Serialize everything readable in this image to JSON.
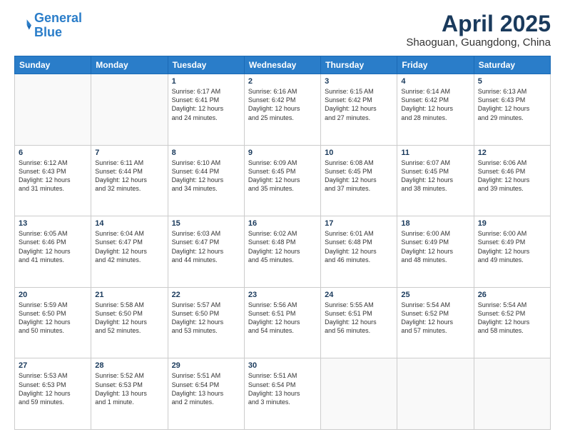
{
  "header": {
    "logo_line1": "General",
    "logo_line2": "Blue",
    "main_title": "April 2025",
    "subtitle": "Shaoguan, Guangdong, China"
  },
  "days_of_week": [
    "Sunday",
    "Monday",
    "Tuesday",
    "Wednesday",
    "Thursday",
    "Friday",
    "Saturday"
  ],
  "weeks": [
    [
      {
        "day": "",
        "sunrise": "",
        "sunset": "",
        "daylight": ""
      },
      {
        "day": "",
        "sunrise": "",
        "sunset": "",
        "daylight": ""
      },
      {
        "day": "1",
        "sunrise": "Sunrise: 6:17 AM",
        "sunset": "Sunset: 6:41 PM",
        "daylight": "Daylight: 12 hours and 24 minutes."
      },
      {
        "day": "2",
        "sunrise": "Sunrise: 6:16 AM",
        "sunset": "Sunset: 6:42 PM",
        "daylight": "Daylight: 12 hours and 25 minutes."
      },
      {
        "day": "3",
        "sunrise": "Sunrise: 6:15 AM",
        "sunset": "Sunset: 6:42 PM",
        "daylight": "Daylight: 12 hours and 27 minutes."
      },
      {
        "day": "4",
        "sunrise": "Sunrise: 6:14 AM",
        "sunset": "Sunset: 6:42 PM",
        "daylight": "Daylight: 12 hours and 28 minutes."
      },
      {
        "day": "5",
        "sunrise": "Sunrise: 6:13 AM",
        "sunset": "Sunset: 6:43 PM",
        "daylight": "Daylight: 12 hours and 29 minutes."
      }
    ],
    [
      {
        "day": "6",
        "sunrise": "Sunrise: 6:12 AM",
        "sunset": "Sunset: 6:43 PM",
        "daylight": "Daylight: 12 hours and 31 minutes."
      },
      {
        "day": "7",
        "sunrise": "Sunrise: 6:11 AM",
        "sunset": "Sunset: 6:44 PM",
        "daylight": "Daylight: 12 hours and 32 minutes."
      },
      {
        "day": "8",
        "sunrise": "Sunrise: 6:10 AM",
        "sunset": "Sunset: 6:44 PM",
        "daylight": "Daylight: 12 hours and 34 minutes."
      },
      {
        "day": "9",
        "sunrise": "Sunrise: 6:09 AM",
        "sunset": "Sunset: 6:45 PM",
        "daylight": "Daylight: 12 hours and 35 minutes."
      },
      {
        "day": "10",
        "sunrise": "Sunrise: 6:08 AM",
        "sunset": "Sunset: 6:45 PM",
        "daylight": "Daylight: 12 hours and 37 minutes."
      },
      {
        "day": "11",
        "sunrise": "Sunrise: 6:07 AM",
        "sunset": "Sunset: 6:45 PM",
        "daylight": "Daylight: 12 hours and 38 minutes."
      },
      {
        "day": "12",
        "sunrise": "Sunrise: 6:06 AM",
        "sunset": "Sunset: 6:46 PM",
        "daylight": "Daylight: 12 hours and 39 minutes."
      }
    ],
    [
      {
        "day": "13",
        "sunrise": "Sunrise: 6:05 AM",
        "sunset": "Sunset: 6:46 PM",
        "daylight": "Daylight: 12 hours and 41 minutes."
      },
      {
        "day": "14",
        "sunrise": "Sunrise: 6:04 AM",
        "sunset": "Sunset: 6:47 PM",
        "daylight": "Daylight: 12 hours and 42 minutes."
      },
      {
        "day": "15",
        "sunrise": "Sunrise: 6:03 AM",
        "sunset": "Sunset: 6:47 PM",
        "daylight": "Daylight: 12 hours and 44 minutes."
      },
      {
        "day": "16",
        "sunrise": "Sunrise: 6:02 AM",
        "sunset": "Sunset: 6:48 PM",
        "daylight": "Daylight: 12 hours and 45 minutes."
      },
      {
        "day": "17",
        "sunrise": "Sunrise: 6:01 AM",
        "sunset": "Sunset: 6:48 PM",
        "daylight": "Daylight: 12 hours and 46 minutes."
      },
      {
        "day": "18",
        "sunrise": "Sunrise: 6:00 AM",
        "sunset": "Sunset: 6:49 PM",
        "daylight": "Daylight: 12 hours and 48 minutes."
      },
      {
        "day": "19",
        "sunrise": "Sunrise: 6:00 AM",
        "sunset": "Sunset: 6:49 PM",
        "daylight": "Daylight: 12 hours and 49 minutes."
      }
    ],
    [
      {
        "day": "20",
        "sunrise": "Sunrise: 5:59 AM",
        "sunset": "Sunset: 6:50 PM",
        "daylight": "Daylight: 12 hours and 50 minutes."
      },
      {
        "day": "21",
        "sunrise": "Sunrise: 5:58 AM",
        "sunset": "Sunset: 6:50 PM",
        "daylight": "Daylight: 12 hours and 52 minutes."
      },
      {
        "day": "22",
        "sunrise": "Sunrise: 5:57 AM",
        "sunset": "Sunset: 6:50 PM",
        "daylight": "Daylight: 12 hours and 53 minutes."
      },
      {
        "day": "23",
        "sunrise": "Sunrise: 5:56 AM",
        "sunset": "Sunset: 6:51 PM",
        "daylight": "Daylight: 12 hours and 54 minutes."
      },
      {
        "day": "24",
        "sunrise": "Sunrise: 5:55 AM",
        "sunset": "Sunset: 6:51 PM",
        "daylight": "Daylight: 12 hours and 56 minutes."
      },
      {
        "day": "25",
        "sunrise": "Sunrise: 5:54 AM",
        "sunset": "Sunset: 6:52 PM",
        "daylight": "Daylight: 12 hours and 57 minutes."
      },
      {
        "day": "26",
        "sunrise": "Sunrise: 5:54 AM",
        "sunset": "Sunset: 6:52 PM",
        "daylight": "Daylight: 12 hours and 58 minutes."
      }
    ],
    [
      {
        "day": "27",
        "sunrise": "Sunrise: 5:53 AM",
        "sunset": "Sunset: 6:53 PM",
        "daylight": "Daylight: 12 hours and 59 minutes."
      },
      {
        "day": "28",
        "sunrise": "Sunrise: 5:52 AM",
        "sunset": "Sunset: 6:53 PM",
        "daylight": "Daylight: 13 hours and 1 minute."
      },
      {
        "day": "29",
        "sunrise": "Sunrise: 5:51 AM",
        "sunset": "Sunset: 6:54 PM",
        "daylight": "Daylight: 13 hours and 2 minutes."
      },
      {
        "day": "30",
        "sunrise": "Sunrise: 5:51 AM",
        "sunset": "Sunset: 6:54 PM",
        "daylight": "Daylight: 13 hours and 3 minutes."
      },
      {
        "day": "",
        "sunrise": "",
        "sunset": "",
        "daylight": ""
      },
      {
        "day": "",
        "sunrise": "",
        "sunset": "",
        "daylight": ""
      },
      {
        "day": "",
        "sunrise": "",
        "sunset": "",
        "daylight": ""
      }
    ]
  ]
}
